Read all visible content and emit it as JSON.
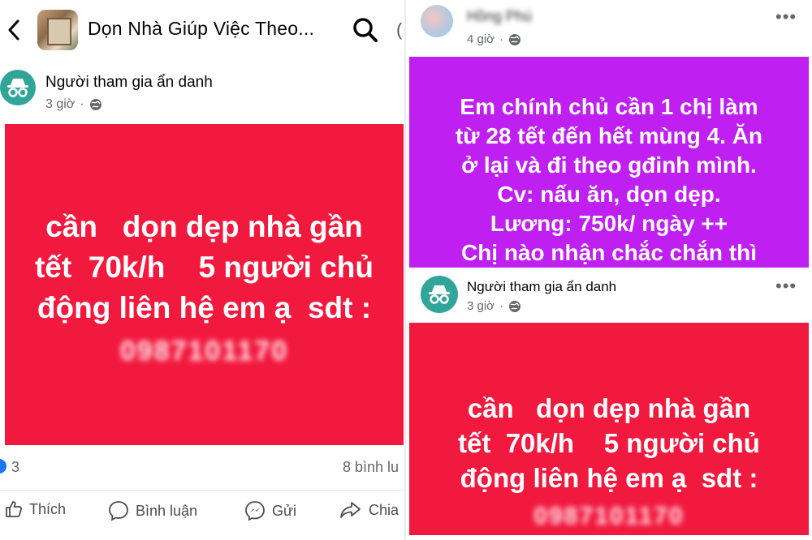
{
  "left": {
    "group_title": "Dọn Nhà Giúp Việc Theo...",
    "post": {
      "author": "Người tham gia ẩn danh",
      "time": "3 giờ",
      "box_color": "#f2193f",
      "lines": [
        "cần   dọn dẹp nhà gần",
        "tết  70k/h    5 người chủ",
        "động liên hệ em ạ  sdt :"
      ],
      "phone": "0987101170"
    },
    "stats": {
      "reactions": "3",
      "comments": "8 bình lu"
    },
    "actions": {
      "like": "Thích",
      "comment": "Bình luận",
      "send": "Gửi",
      "share": "Chia"
    }
  },
  "right": {
    "post1": {
      "author": "Hồng Phú",
      "time": "4 giờ",
      "box_color": "#bf1ff0",
      "lines": [
        "Em chính chủ cần 1 chị làm",
        "từ 28 tết đến hết mùng 4. Ăn",
        "ở lại và đi theo gđinh mình.",
        "Cv: nấu ăn, dọn dẹp.",
        "Lương: 750k/ ngày ++",
        "Chị nào nhận chắc chắn thì"
      ]
    },
    "post2": {
      "author": "Người tham gia ẩn danh",
      "time": "3 giờ",
      "box_color": "#f2193f",
      "lines": [
        "cần   dọn dẹp nhà gần",
        "tết  70k/h    5 người chủ",
        "động liên hệ em ạ  sdt :"
      ],
      "phone": "0987101170"
    }
  },
  "icons": [
    "back-arrow-icon",
    "search-icon",
    "anonymous-icon",
    "globe-icon",
    "more-icon",
    "like-icon",
    "comment-icon",
    "messenger-icon",
    "share-icon"
  ]
}
